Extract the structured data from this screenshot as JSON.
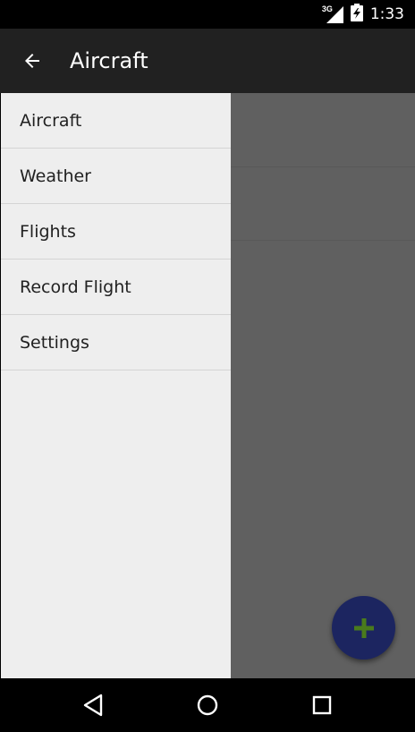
{
  "status_bar": {
    "network": "3G",
    "time": "1:33"
  },
  "app_bar": {
    "title": "Aircraft"
  },
  "drawer": {
    "items": [
      {
        "label": "Aircraft"
      },
      {
        "label": "Weather"
      },
      {
        "label": "Flights"
      },
      {
        "label": "Record Flight"
      },
      {
        "label": "Settings"
      }
    ]
  },
  "fab": {
    "icon": "plus-icon",
    "color": "#1c2560",
    "icon_color": "#4a7b1c"
  },
  "colors": {
    "app_bar": "#212121",
    "drawer": "#eeeeee",
    "scrim": "#606060"
  }
}
